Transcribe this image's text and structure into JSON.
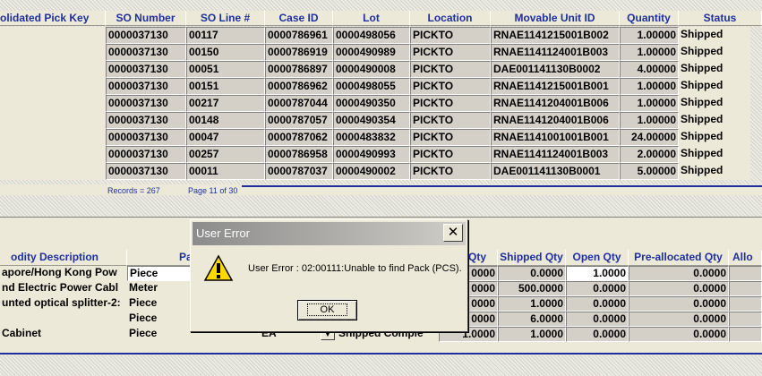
{
  "top_grid": {
    "headers": [
      "olidated Pick Key",
      "SO Number",
      "SO Line #",
      "Case ID",
      "Lot",
      "Location",
      "Movable Unit ID",
      "Quantity",
      "Status"
    ],
    "rows": [
      [
        "",
        "0000037130",
        "00117",
        "0000786961",
        "0000498056",
        "PICKTO",
        "RNAE1141215001B002",
        "1.00000",
        "Shipped"
      ],
      [
        "",
        "0000037130",
        "00150",
        "0000786919",
        "0000490989",
        "PICKTO",
        "RNAE1141124001B003",
        "1.00000",
        "Shipped"
      ],
      [
        "",
        "0000037130",
        "00051",
        "0000786897",
        "0000490008",
        "PICKTO",
        "DAE001141130B0002",
        "4.00000",
        "Shipped"
      ],
      [
        "",
        "0000037130",
        "00151",
        "0000786962",
        "0000498055",
        "PICKTO",
        "RNAE1141215001B001",
        "1.00000",
        "Shipped"
      ],
      [
        "",
        "0000037130",
        "00217",
        "0000787044",
        "0000490350",
        "PICKTO",
        "RNAE1141204001B006",
        "1.00000",
        "Shipped"
      ],
      [
        "",
        "0000037130",
        "00148",
        "0000787057",
        "0000490354",
        "PICKTO",
        "RNAE1141204001B006",
        "1.00000",
        "Shipped"
      ],
      [
        "",
        "0000037130",
        "00047",
        "0000787062",
        "0000483832",
        "PICKTO",
        "RNAE1141001001B001",
        "24.00000",
        "Shipped"
      ],
      [
        "",
        "0000037130",
        "00257",
        "0000786958",
        "0000490993",
        "PICKTO",
        "RNAE1141124001B003",
        "2.00000",
        "Shipped"
      ],
      [
        "",
        "0000037130",
        "00011",
        "0000787037",
        "0000490002",
        "PICKTO",
        "DAE001141130B0001",
        "5.00000",
        "Shipped"
      ]
    ],
    "records": "Records = 267",
    "page": "Page 11 of 30"
  },
  "bottom_grid": {
    "headers": [
      "odity Description",
      "Pa",
      "Qty",
      "Shipped Qty",
      "Open Qty",
      "Pre-allocated Qty",
      "Allo"
    ],
    "rows": [
      {
        "desc": "apore/Hong Kong Pow",
        "pack": "Piece",
        "qty": "0000",
        "shipped": "0.0000",
        "open": "1.0000",
        "prealloc": "0.0000"
      },
      {
        "desc": "nd Electric Power Cabl",
        "pack": "Meter",
        "qty": "0000",
        "shipped": "500.0000",
        "open": "0.0000",
        "prealloc": "0.0000"
      },
      {
        "desc": "unted optical splitter-2:",
        "pack": "Piece",
        "qty": "0000",
        "shipped": "1.0000",
        "open": "0.0000",
        "prealloc": "0.0000"
      },
      {
        "desc": "",
        "pack": "Piece",
        "qty": "0000",
        "shipped": "6.0000",
        "open": "0.0000",
        "prealloc": "0.0000"
      },
      {
        "desc": "Cabinet",
        "pack": "Piece",
        "uom": "EA",
        "status": "Shipped Comple",
        "qty": "1.0000",
        "shipped": "1.0000",
        "open": "0.0000",
        "prealloc": "0.0000"
      }
    ]
  },
  "dialog": {
    "title": "User Error",
    "close": "✕",
    "message": "User Error : 02:00111:Unable to find Pack (PCS).",
    "ok": "OK"
  },
  "colors": {
    "header_text": "#1e2fa0",
    "divider": "#1e2fa0",
    "warning": "#ffd800"
  }
}
